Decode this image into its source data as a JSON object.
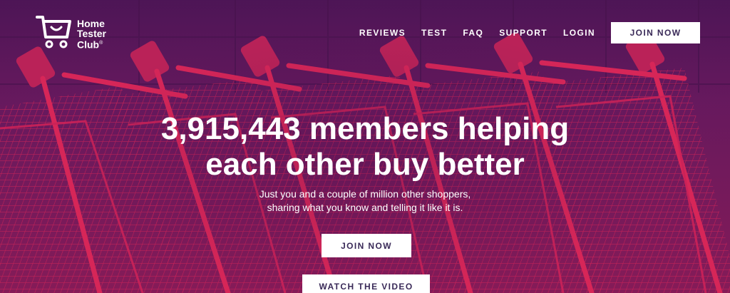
{
  "logo": {
    "line1": "Home",
    "line2": "Tester",
    "line3": "Club",
    "registered": "®"
  },
  "nav": {
    "items": [
      {
        "label": "REVIEWS"
      },
      {
        "label": "TEST"
      },
      {
        "label": "FAQ"
      },
      {
        "label": "SUPPORT"
      },
      {
        "label": "LOGIN"
      }
    ],
    "join_label": "JOIN NOW"
  },
  "hero": {
    "headline_line1": "3,915,443 members helping",
    "headline_line2": "each other buy better",
    "sub_line1": "Just you and a couple of million other shoppers,",
    "sub_line2": "sharing what you know and telling it like it is.",
    "cta_join": "JOIN NOW",
    "cta_video": "WATCH THE VIDEO"
  },
  "colors": {
    "background": "#5a1a5e",
    "cart_red": "#e0285a",
    "button_text": "#3a2a58"
  },
  "icons": {
    "logo": "shopping-cart-icon"
  }
}
